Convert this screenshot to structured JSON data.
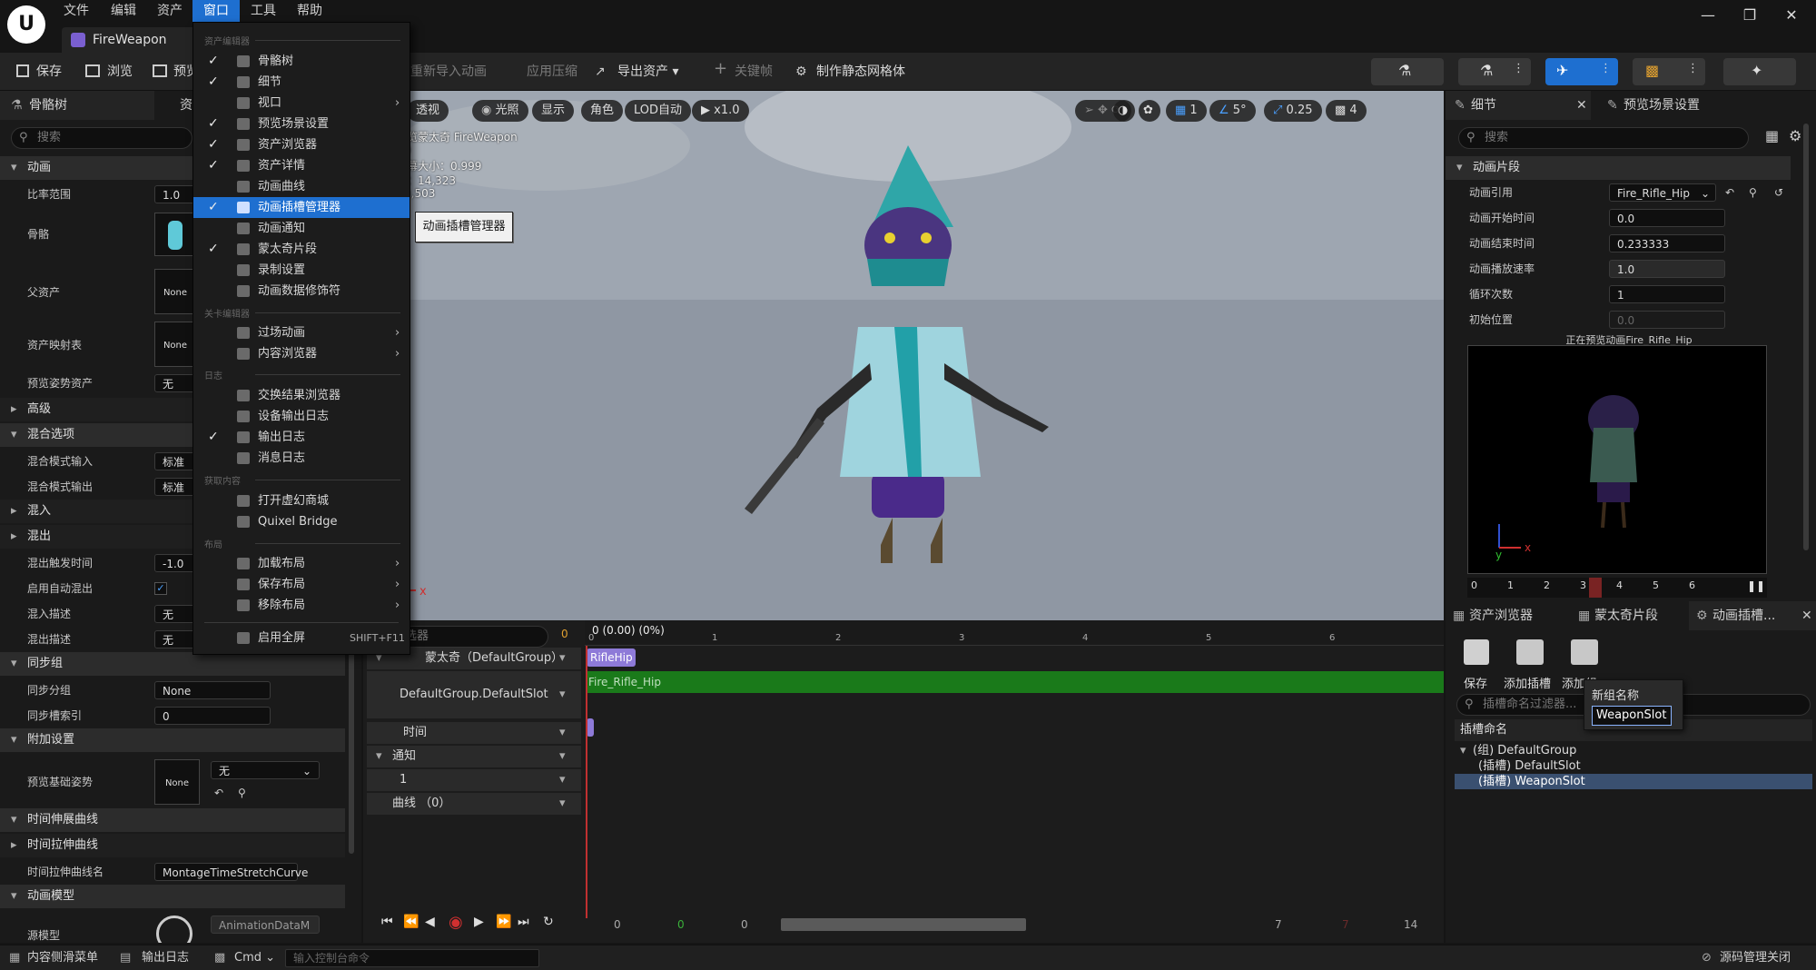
{
  "menubar": {
    "items": [
      "文件",
      "编辑",
      "资产",
      "窗口",
      "工具",
      "帮助"
    ],
    "active": "窗口"
  },
  "document_tab": "FireWeapon",
  "toolbar": {
    "save": "保存",
    "browse": "浏览",
    "preview": "预览",
    "reimport": "重新导入动画",
    "apply_compression": "应用压缩",
    "export_asset": "导出资产",
    "keyframe": "关键帧",
    "make_static_mesh": "制作静态网格体"
  },
  "left_panel": {
    "tab_skeleton": "骨骼树",
    "tab_asset": "资",
    "search_placeholder": "搜索",
    "sections": {
      "animation": "动画",
      "advanced": "高级",
      "blend_options": "混合选项",
      "blend_in": "混入",
      "blend_out": "混出",
      "sync_group": "同步组",
      "additive": "附加设置",
      "time_stretch": "时间伸展曲线",
      "anim_model": "动画模型"
    },
    "rows": {
      "rate_scale": "比率范围",
      "rate_scale_value": "1.0",
      "skeleton": "骨骼",
      "parent_asset": "父资产",
      "parent_asset_value": "None",
      "asset_mapping": "资产映射表",
      "asset_mapping_value": "None",
      "preview_pose": "预览姿势资产",
      "preview_pose_value": "无",
      "blend_mode_in": "混合模式输入",
      "blend_mode_in_value": "标准",
      "blend_mode_out": "混合模式输出",
      "blend_mode_out_value": "标准",
      "blend_trigger": "混出触发时间",
      "blend_trigger_value": "-1.0",
      "auto_blend": "启用自动混出",
      "blend_in_desc": "混入描述",
      "blend_in_desc_value": "无",
      "blend_out_desc": "混出描述",
      "blend_out_desc_value": "无",
      "sync_group": "同步分组",
      "sync_group_value": "None",
      "sync_slot_index": "同步槽索引",
      "sync_slot_index_value": "0",
      "preview_base_pose": "预览基础姿势",
      "preview_base_pose_value": "None",
      "preview_base_pose_dropdown": "无",
      "time_stretch_sub": "时间拉伸曲线",
      "time_stretch_name": "时间拉伸曲线名",
      "time_stretch_name_value": "MontageTimeStretchCurve",
      "anim_model_dropdown": "AnimationDataM",
      "source_model": "源模型"
    }
  },
  "window_menu": {
    "header_asset_editor": "资产编辑器",
    "header_level_editor": "关卡编辑器",
    "header_log": "日志",
    "header_get_content": "获取内容",
    "header_layout": "布局",
    "items": [
      {
        "label": "骨骼树",
        "checked": true
      },
      {
        "label": "细节",
        "checked": true
      },
      {
        "label": "视口",
        "checked": false,
        "submenu": true
      },
      {
        "label": "预览场景设置",
        "checked": true
      },
      {
        "label": "资产浏览器",
        "checked": true
      },
      {
        "label": "资产详情",
        "checked": true
      },
      {
        "label": "动画曲线",
        "checked": false
      },
      {
        "label": "动画插槽管理器",
        "checked": true,
        "highlighted": true
      },
      {
        "label": "动画通知",
        "checked": false
      },
      {
        "label": "蒙太奇片段",
        "checked": true
      },
      {
        "label": "录制设置",
        "checked": false
      },
      {
        "label": "动画数据修饰符",
        "checked": false
      }
    ],
    "level_items": [
      {
        "label": "过场动画",
        "submenu": true
      },
      {
        "label": "内容浏览器",
        "submenu": true
      }
    ],
    "log_items": [
      {
        "label": "交换结果浏览器",
        "checked": false
      },
      {
        "label": "设备输出日志",
        "checked": false
      },
      {
        "label": "输出日志",
        "checked": true
      },
      {
        "label": "消息日志",
        "checked": false
      }
    ],
    "content_items": [
      {
        "label": "打开虚幻商城"
      },
      {
        "label": "Quixel Bridge"
      }
    ],
    "layout_items": [
      {
        "label": "加载布局",
        "submenu": true
      },
      {
        "label": "保存布局",
        "submenu": true
      },
      {
        "label": "移除布局",
        "submenu": true
      }
    ],
    "fullscreen": {
      "label": "启用全屏",
      "shortcut": "SHIFT+F11"
    }
  },
  "tooltip": "动画插槽管理器",
  "viewport": {
    "perspective": "透视",
    "lighting": "光照",
    "show": "显示",
    "character": "角色",
    "lod": "LOD自动",
    "speed": "x1.0",
    "grid_value": "1",
    "angle_value": "5°",
    "scale_value": "0.25",
    "camera_speed": "4",
    "info_line1": "览蒙太奇 FireWeapon",
    "info_line2": ")",
    "info_line3": "幕大小：0.999",
    "info_line4": "：14,323",
    "info_line5": "),503"
  },
  "details": {
    "tab_details": "细节",
    "tab_preview": "预览场景设置",
    "search_placeholder": "搜索",
    "section": "动画片段",
    "anim_ref_label": "动画引用",
    "anim_ref_value": "Fire_Rifle_Hip",
    "start_label": "动画开始时间",
    "start_value": "0.0",
    "end_label": "动画结束时间",
    "end_value": "0.233333",
    "rate_label": "动画播放速率",
    "rate_value": "1.0",
    "loop_label": "循环次数",
    "loop_value": "1",
    "init_label": "初始位置",
    "init_value": "0.0",
    "preview_caption": "正在预览动画Fire_Rifle_Hip",
    "timeline_ticks": [
      "0",
      "1",
      "2",
      "3",
      "4",
      "5",
      "6"
    ]
  },
  "sequencer": {
    "filter_placeholder": "筛选器",
    "counter": "0",
    "time_readout": "0 (0.00) (0%)",
    "ruler_ticks": [
      "0",
      "1",
      "2",
      "3",
      "4",
      "5",
      "6"
    ],
    "montage_track": "蒙太奇（DefaultGroup）",
    "section_label": "RifleHip",
    "slot_track": "DefaultGroup.DefaultSlot",
    "clip_label": "Fire_Rifle_Hip",
    "time_track": "时间",
    "notify_track": "通知",
    "notify_sub": "1",
    "curves_track": "曲线 （0）",
    "bottom_left": "0",
    "bottom_green": "0",
    "bottom_mid": "0",
    "bottom_r1": "7",
    "bottom_r2": "7",
    "bottom_r3": "14"
  },
  "slots": {
    "tab_asset_browser": "资产浏览器",
    "tab_montage_sections": "蒙太奇片段",
    "tab_slot_manager": "动画插槽...",
    "btn_save": "保存",
    "btn_add_slot": "添加插槽",
    "btn_add_group": "添加组",
    "filter_placeholder": "插槽命名过滤器...",
    "column": "插槽命名",
    "tree": [
      "(组) DefaultGroup",
      "(插槽) DefaultSlot",
      "(插槽) WeaponSlot"
    ],
    "popup_title": "新组名称",
    "popup_value": "WeaponSlot"
  },
  "statusbar": {
    "content_drawer": "内容侧滑菜单",
    "output_log": "输出日志",
    "cmd": "Cmd",
    "console_placeholder": "输入控制台命令",
    "source_control": "源码管理关闭"
  },
  "colors": {
    "accent": "#1e6fd0",
    "montage_section": "#8e7ad8",
    "slot_clip": "#1a7a1a",
    "playhead": "#c03030"
  }
}
